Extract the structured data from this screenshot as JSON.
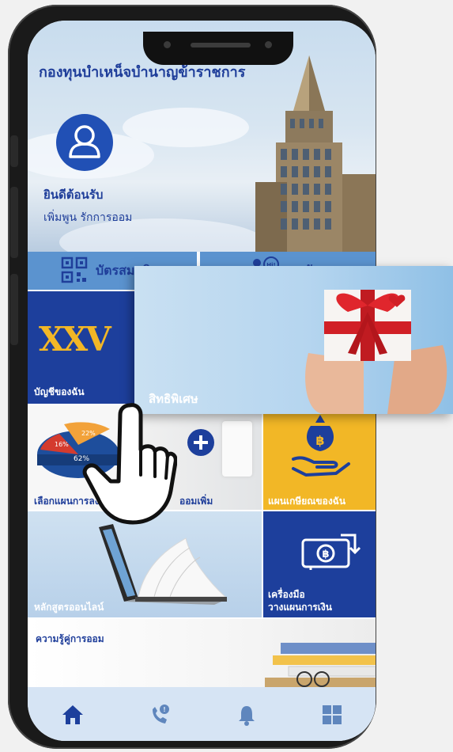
{
  "header": {
    "title": "กองทุนบำเหน็จบำนาญข้าราชการ",
    "welcome": "ยินดีต้อนรับ",
    "slogan": "เพิ่มพูน รักการออม"
  },
  "quick_links": [
    {
      "label": "บัตรสมาชิก",
      "icon": "qr-code-icon"
    },
    {
      "label": "คุยกับเรา",
      "icon": "chat-bot-icon"
    }
  ],
  "tiles": {
    "my_account": {
      "label": "บัญชีของฉัน",
      "logo_text": "XXV"
    },
    "choose_plan": {
      "label": "เลือกแผนการลงทุน",
      "pie_labels": [
        "22%",
        "16%",
        "62%"
      ]
    },
    "save_more": {
      "label": "ออมเพิ่ม"
    },
    "retirement_plan": {
      "label": "แผนเกษียณของฉัน"
    },
    "online_course": {
      "label": "หลักสูตรออนไลน์"
    },
    "planning_tools": {
      "label_line1": "เครื่องมือ",
      "label_line2": "วางแผนการเงิน"
    },
    "savings_knowledge": {
      "label": "ความรู้คู่การออม"
    }
  },
  "popup": {
    "label": "สิทธิพิเศษ"
  },
  "bottom_nav": [
    {
      "name": "home-icon",
      "active": true
    },
    {
      "name": "phone-icon",
      "active": false
    },
    {
      "name": "bell-icon",
      "active": false
    },
    {
      "name": "grid-icon",
      "active": false
    }
  ],
  "colors": {
    "primary": "#1f3e9a",
    "accent_yellow": "#f2b726",
    "tile_blue": "#1d3f9c",
    "nav_bg": "#d6e4f4"
  }
}
